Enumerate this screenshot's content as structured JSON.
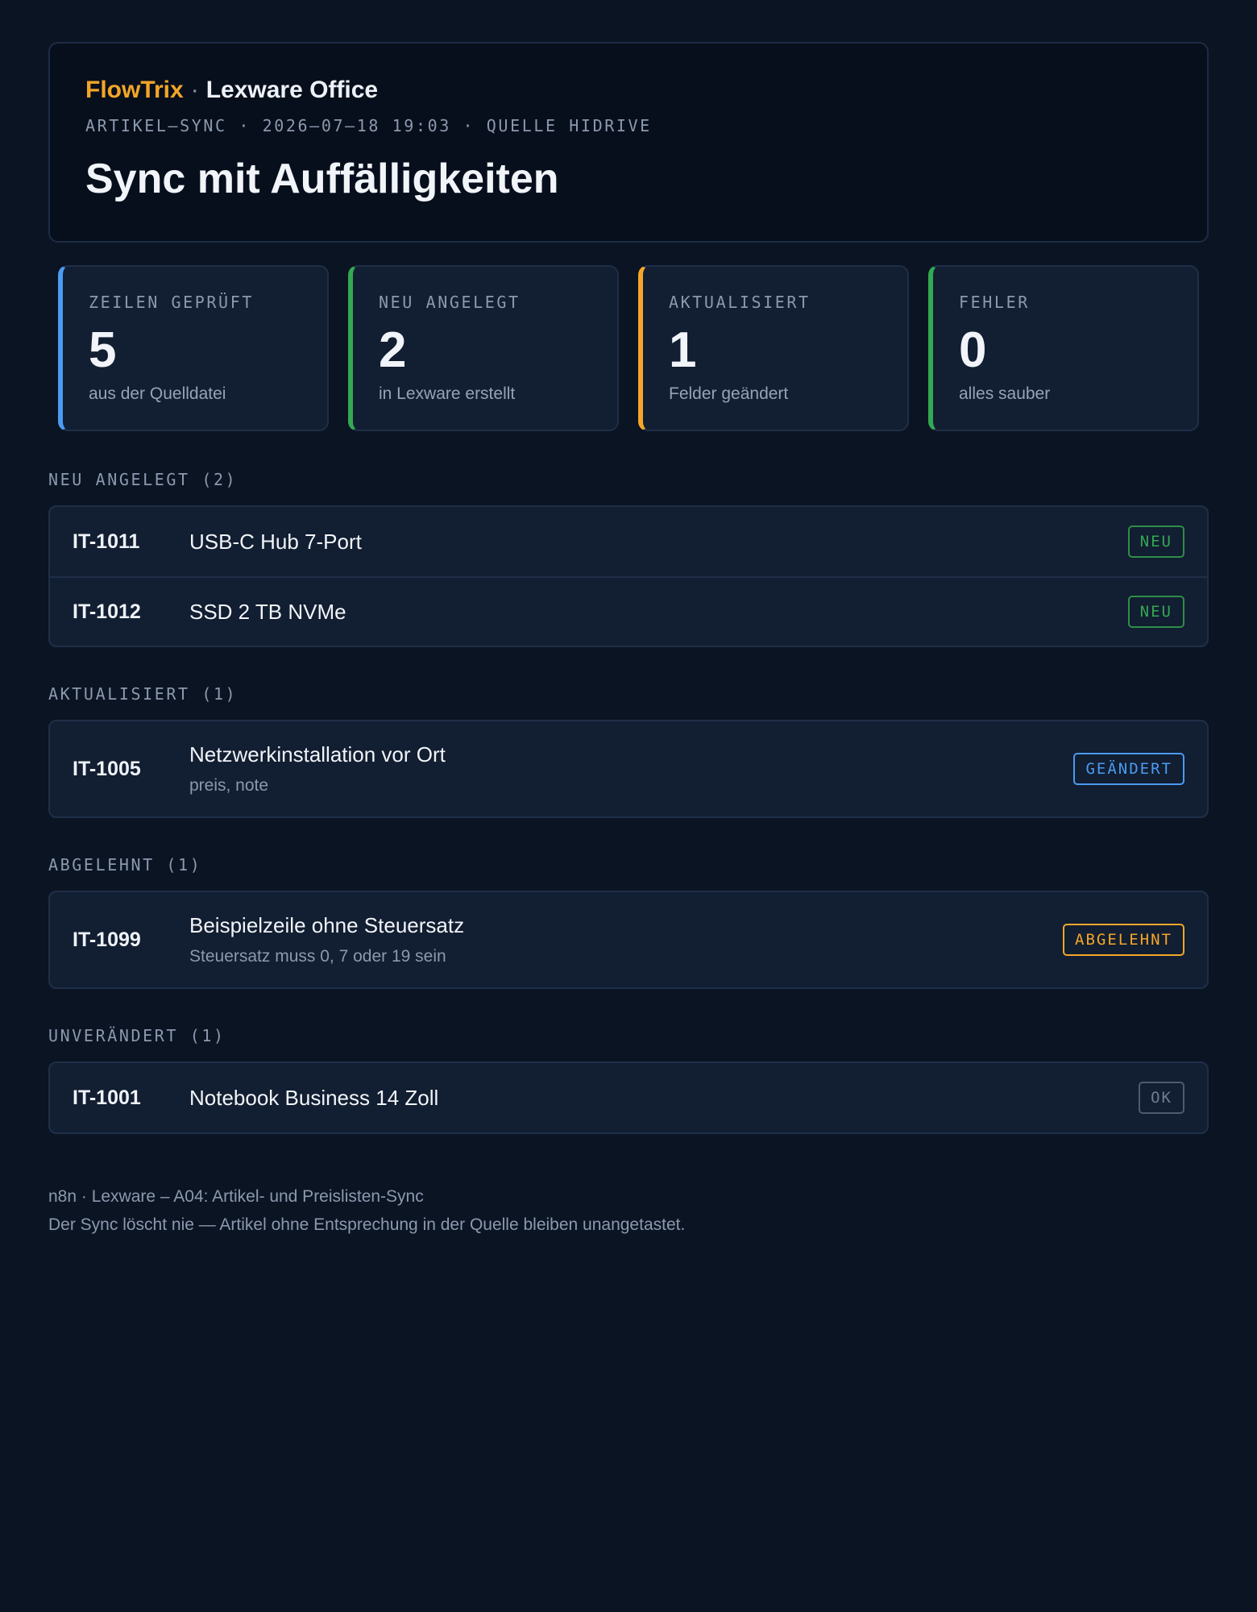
{
  "header": {
    "brand": "FlowTrix",
    "separator": "·",
    "product": "Lexware Office",
    "meta": "ARTIKEL–SYNC · 2026–07–18 19:03 · QUELLE HIDRIVE",
    "title": "Sync mit Auffälligkeiten"
  },
  "stats": [
    {
      "label": "ZEILEN GEPRÜFT",
      "value": "5",
      "sub": "aus der Quelldatei",
      "accent": "#4b9bf2"
    },
    {
      "label": "NEU ANGELEGT",
      "value": "2",
      "sub": "in Lexware erstellt",
      "accent": "#34a853"
    },
    {
      "label": "AKTUALISIERT",
      "value": "1",
      "sub": "Felder geändert",
      "accent": "#f4a62a"
    },
    {
      "label": "FEHLER",
      "value": "0",
      "sub": "alles sauber",
      "accent": "#34a853"
    }
  ],
  "sections": {
    "neu": {
      "heading": "NEU ANGELEGT (2)",
      "rows": [
        {
          "sku": "IT-1011",
          "name": "USB-C Hub 7-Port",
          "badge": "NEU"
        },
        {
          "sku": "IT-1012",
          "name": "SSD 2 TB NVMe",
          "badge": "NEU"
        }
      ]
    },
    "aktualisiert": {
      "heading": "AKTUALISIERT (1)",
      "rows": [
        {
          "sku": "IT-1005",
          "name": "Netzwerkinstallation vor Ort",
          "detail": "preis, note",
          "badge": "GEÄNDERT"
        }
      ]
    },
    "abgelehnt": {
      "heading": "ABGELEHNT (1)",
      "rows": [
        {
          "sku": "IT-1099",
          "name": "Beispielzeile ohne Steuersatz",
          "detail": "Steuersatz muss 0, 7 oder 19 sein",
          "badge": "ABGELEHNT"
        }
      ]
    },
    "unveraendert": {
      "heading": "UNVERÄNDERT (1)",
      "rows": [
        {
          "sku": "IT-1001",
          "name": "Notebook Business 14 Zoll",
          "badge": "OK"
        }
      ]
    }
  },
  "footer": {
    "line1": "n8n · Lexware – A04: Artikel- und Preislisten-Sync",
    "line2": "Der Sync löscht nie — Artikel ohne Entsprechung in der Quelle bleiben unangetastet."
  },
  "colors": {
    "background": "#0b1423",
    "brand": "#f2a627",
    "status_new": "#34a853",
    "status_changed": "#4b9bf2",
    "status_rejected": "#f4a62a",
    "status_ok": "#6f7c90"
  }
}
